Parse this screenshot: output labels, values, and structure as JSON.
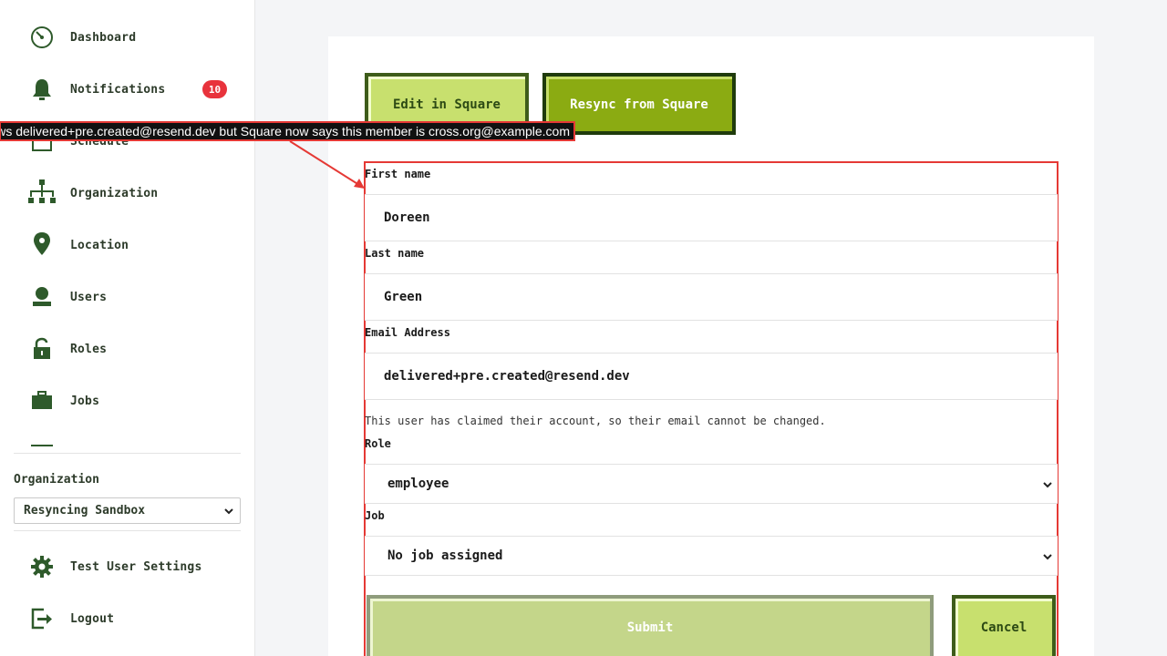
{
  "sidebar": {
    "items": [
      {
        "label": "Dashboard",
        "icon": "dashboard-icon"
      },
      {
        "label": "Notifications",
        "icon": "bell-icon",
        "badge": "10"
      },
      {
        "label": "Schedule",
        "icon": "calendar-icon"
      },
      {
        "label": "Organization",
        "icon": "org-chart-icon"
      },
      {
        "label": "Location",
        "icon": "map-pin-icon"
      },
      {
        "label": "Users",
        "icon": "user-icon"
      },
      {
        "label": "Roles",
        "icon": "lock-icon"
      },
      {
        "label": "Jobs",
        "icon": "briefcase-icon"
      }
    ],
    "organization_label": "Organization",
    "organization_selected": "Resyncing Sandbox",
    "footer_items": [
      {
        "label": "Test User Settings",
        "icon": "gear-icon"
      },
      {
        "label": "Logout",
        "icon": "logout-icon"
      }
    ]
  },
  "actions": {
    "edit_label": "Edit in Square",
    "resync_label": "Resync from Square"
  },
  "form": {
    "first_name_label": "First name",
    "first_name_value": "Doreen",
    "last_name_label": "Last name",
    "last_name_value": "Green",
    "email_label": "Email Address",
    "email_value": "delivered+pre.created@resend.dev",
    "email_help": "This user has claimed their account, so their email cannot be changed.",
    "role_label": "Role",
    "role_value": "employee",
    "job_label": "Job",
    "job_value": "No job assigned",
    "submit_label": "Submit",
    "cancel_label": "Cancel"
  },
  "annotation": {
    "text": "ws delivered+pre.created@resend.dev but Square now says this member is cross.org@example.com"
  },
  "colors": {
    "accent_light": "#c8e06e",
    "accent_dark": "#8bab12",
    "badge": "#e8333c",
    "annotation_border": "#e53935"
  }
}
